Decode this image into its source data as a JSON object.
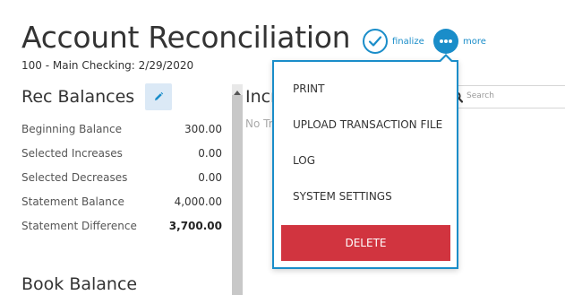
{
  "header": {
    "title": "Account Reconciliation",
    "subtitle": "100 - Main Checking: 2/29/2020"
  },
  "actions": {
    "finalize_label": "finalize",
    "more_label": "more"
  },
  "rec_balances": {
    "title": "Rec Balances",
    "rows": [
      {
        "label": "Beginning Balance",
        "value": "300.00"
      },
      {
        "label": "Selected Increases",
        "value": "0.00"
      },
      {
        "label": "Selected Decreases",
        "value": "0.00"
      },
      {
        "label": "Statement Balance",
        "value": "4,000.00"
      },
      {
        "label": "Statement Difference",
        "value": "3,700.00"
      }
    ]
  },
  "book_balance": {
    "title": "Book Balance"
  },
  "increases_panel": {
    "title": "Incr",
    "empty_text": "No Tr"
  },
  "search": {
    "placeholder": "Search"
  },
  "more_menu": {
    "items": [
      {
        "label": "PRINT"
      },
      {
        "label": "UPLOAD TRANSACTION FILE"
      },
      {
        "label": "LOG"
      },
      {
        "label": "SYSTEM SETTINGS"
      }
    ],
    "delete_label": "DELETE"
  },
  "colors": {
    "accent": "#1a8dc9",
    "danger": "#d1343f",
    "edit_bg": "#dbe9f6"
  },
  "icons": {
    "finalize": "check-circle-icon",
    "more": "ellipsis-circle-icon",
    "edit": "pencil-icon",
    "search": "search-icon",
    "scroll_up": "caret-up-icon"
  }
}
